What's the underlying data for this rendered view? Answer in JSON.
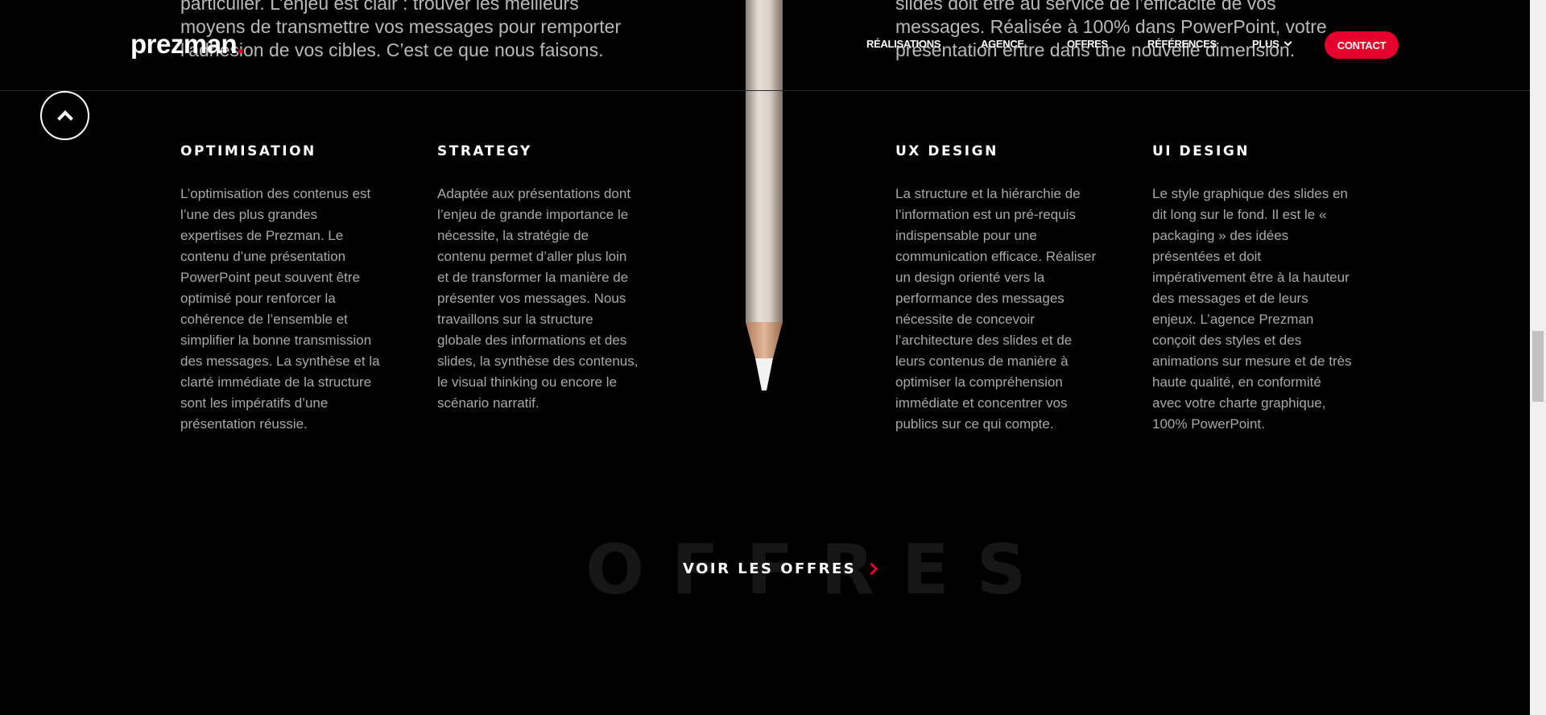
{
  "intro": {
    "left": "particulier. L’enjeu est clair : trouver les meilleurs moyens de transmettre vos messages pour remporter l’adhésion de vos cibles. C’est ce que nous faisons.",
    "right": "slides doit être au service de l’efficacité de vos messages. Réalisée à 100% dans PowerPoint, votre présentation entre dans une nouvelle dimension."
  },
  "header": {
    "logo_text": "prezman",
    "logo_dot": ".",
    "nav": [
      "RÉALISATIONS",
      "AGENCE",
      "OFFRES",
      "RÉFÉRENCES",
      "PLUS"
    ],
    "contact": "CONTACT"
  },
  "columns": [
    {
      "title": "OPTIMISATION",
      "text": "L’optimisation des contenus est l’une des plus grandes expertises de Prezman. Le contenu d’une présentation PowerPoint peut souvent être optimisé pour renforcer la cohérence de l’ensemble et simplifier la bonne transmission des messages. La synthèse et la clarté immédiate de la structure sont les impératifs d’une présentation réussie."
    },
    {
      "title": "STRATEGY",
      "text": "Adaptée aux présentations dont l’enjeu de grande importance le nécessite, la stratégie de contenu permet d’aller plus loin et de transformer la manière de présenter vos messages. Nous travaillons sur la structure globale des informations et des slides, la synthèse des contenus, le visual thinking ou encore le scénario narratif."
    },
    {
      "title": "UX DESIGN",
      "text": "La structure et la hiérarchie de l’information est un pré-requis indispensable pour une communication efficace. Réaliser un design orienté vers la performance des messages nécessite de concevoir l’architecture des slides et de leurs contenus de manière à optimiser la compréhension immédiate et concentrer vos publics sur ce qui compte."
    },
    {
      "title": "UI DESIGN",
      "text": "Le style graphique des slides en dit long sur le fond. Il est le « packaging » des idées présentées et doit impérativement être à la hauteur des messages et de leurs enjeux. L’agence Prezman conçoit des styles et des animations sur mesure et de très haute qualité, en conformité avec votre charte graphique, 100% PowerPoint."
    }
  ],
  "offres": {
    "background_word": "OFFRES",
    "link": "VOIR LES OFFRES"
  },
  "icons": {
    "back_to_top": "chevron-up-icon",
    "plus_chevron": "chevron-down-icon",
    "offres_arrow": "chevron-right-icon"
  },
  "colors": {
    "accent": "#e4002b",
    "background": "#000000",
    "text_muted": "#a8a8a8"
  }
}
